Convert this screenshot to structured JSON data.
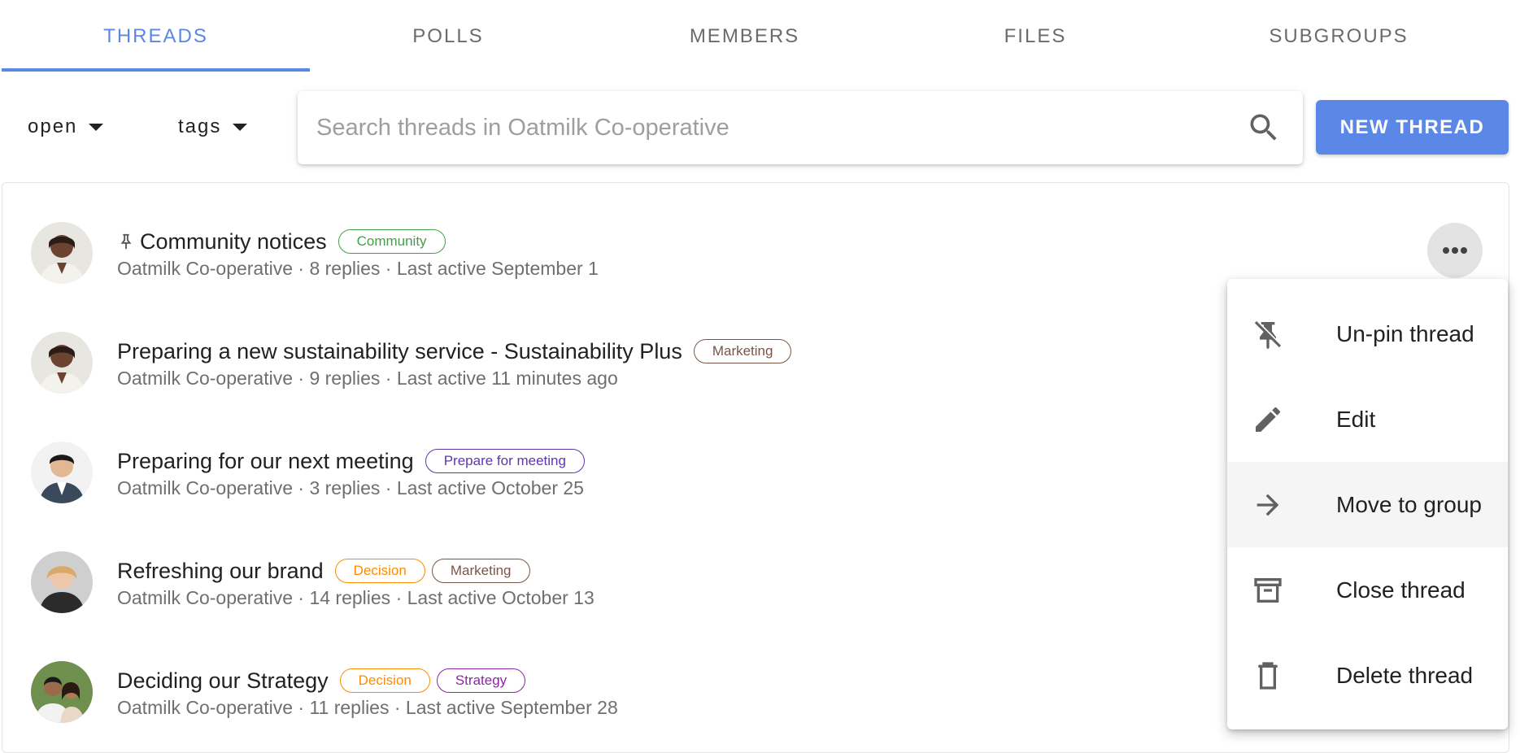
{
  "tabs": [
    {
      "label": "THREADS",
      "active": true
    },
    {
      "label": "POLLS",
      "active": false
    },
    {
      "label": "MEMBERS",
      "active": false
    },
    {
      "label": "FILES",
      "active": false
    },
    {
      "label": "SUBGROUPS",
      "active": false
    }
  ],
  "filters": {
    "status": "open",
    "tags": "tags"
  },
  "search": {
    "placeholder": "Search threads in Oatmilk Co-operative",
    "value": ""
  },
  "new_thread_label": "NEW THREAD",
  "colors": {
    "accent": "#5b87e6",
    "tag_community": "#43a047",
    "tag_marketing": "#795548",
    "tag_prepare": "#5e35b1",
    "tag_decision": "#fb8c00",
    "tag_strategy": "#8e24aa"
  },
  "threads": [
    {
      "title": "Community notices",
      "pinned": true,
      "tags": [
        {
          "label": "Community",
          "color": "#43a047"
        }
      ],
      "meta": "Oatmilk Co-operative · 8 replies  · Last active September 1",
      "avatar": "woman-avatar"
    },
    {
      "title": "Preparing a new sustainability service - Sustainability Plus",
      "pinned": false,
      "tags": [
        {
          "label": "Marketing",
          "color": "#795548"
        }
      ],
      "meta": "Oatmilk Co-operative · 9 replies  · Last active 11 minutes ago",
      "avatar": "woman-avatar"
    },
    {
      "title": "Preparing for our next meeting",
      "pinned": false,
      "tags": [
        {
          "label": "Prepare for meeting",
          "color": "#5e35b1"
        }
      ],
      "meta": "Oatmilk Co-operative · 3 replies  · Last active October 25",
      "avatar": "man-avatar"
    },
    {
      "title": "Refreshing our brand",
      "pinned": false,
      "tags": [
        {
          "label": "Decision",
          "color": "#fb8c00"
        },
        {
          "label": "Marketing",
          "color": "#795548"
        }
      ],
      "meta": "Oatmilk Co-operative · 14 replies  · Last active October 13",
      "avatar": "woman-avatar"
    },
    {
      "title": "Deciding our Strategy",
      "pinned": false,
      "tags": [
        {
          "label": "Decision",
          "color": "#fb8c00"
        },
        {
          "label": "Strategy",
          "color": "#8e24aa"
        }
      ],
      "meta": "Oatmilk Co-operative · 11 replies  · Last active September 28",
      "avatar": "family-avatar"
    }
  ],
  "menu": {
    "items": [
      {
        "label": "Un-pin thread",
        "icon": "unpin-icon"
      },
      {
        "label": "Edit",
        "icon": "pencil-icon"
      },
      {
        "label": "Move to group",
        "icon": "arrow-right-icon",
        "highlighted": true
      },
      {
        "label": "Close thread",
        "icon": "archive-icon"
      },
      {
        "label": "Delete thread",
        "icon": "trash-icon"
      }
    ]
  }
}
